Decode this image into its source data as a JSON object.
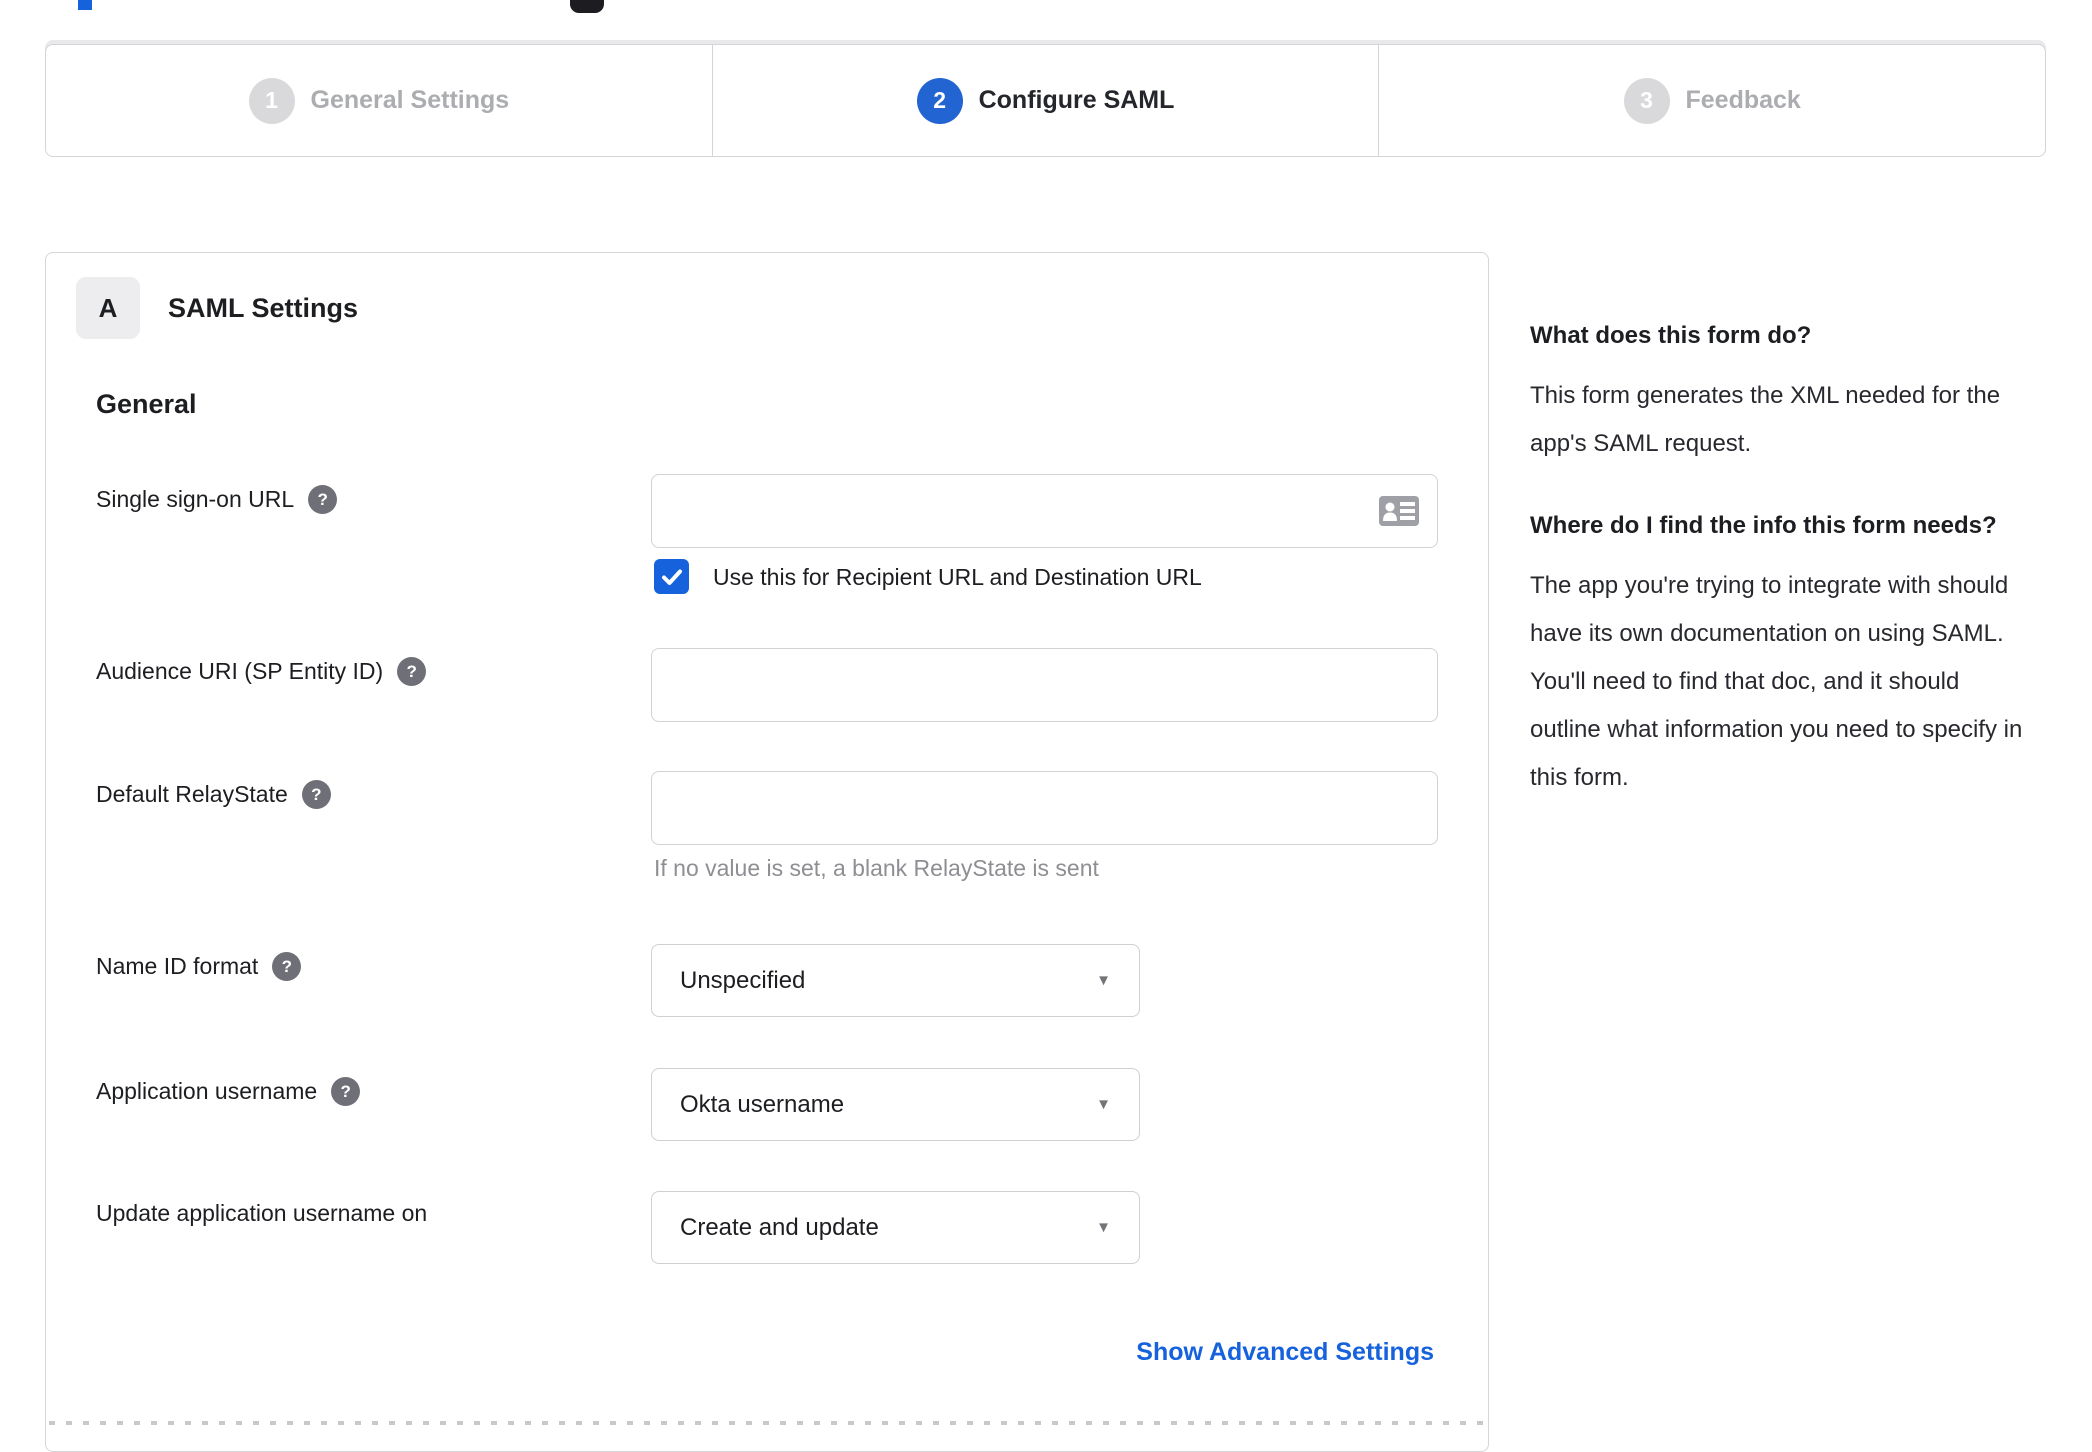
{
  "colors": {
    "accent_blue": "#1662dd",
    "active_step_blue": "#2264d1",
    "inactive_gray": "#abadb0",
    "help_icon_gray": "#6f6f78"
  },
  "stepper": {
    "steps": [
      {
        "number": "1",
        "label": "General Settings",
        "state": "inactive"
      },
      {
        "number": "2",
        "label": "Configure SAML",
        "state": "active"
      },
      {
        "number": "3",
        "label": "Feedback",
        "state": "inactive"
      }
    ]
  },
  "panel": {
    "badge": "A",
    "title": "SAML Settings",
    "section_heading": "General",
    "help_glyph": "?",
    "fields": {
      "sso_url": {
        "label": "Single sign-on URL",
        "value": ""
      },
      "sso_checkbox": {
        "label": "Use this for Recipient URL and Destination URL",
        "checked": true
      },
      "audience_uri": {
        "label": "Audience URI (SP Entity ID)",
        "value": ""
      },
      "relay_state": {
        "label": "Default RelayState",
        "value": "",
        "hint": "If no value is set, a blank RelayState is sent"
      },
      "name_id_format": {
        "label": "Name ID format",
        "value": "Unspecified"
      },
      "app_username": {
        "label": "Application username",
        "value": "Okta username"
      },
      "update_app_username": {
        "label": "Update application username on",
        "value": "Create and update"
      }
    },
    "advanced_link": "Show Advanced Settings"
  },
  "sidebar": {
    "sections": [
      {
        "heading": "What does this form do?",
        "body": "This form generates the XML needed for the app's SAML request."
      },
      {
        "heading": "Where do I find the info this form needs?",
        "body": "The app you're trying to integrate with should have its own documentation on using SAML. You'll need to find that doc, and it should outline what information you need to specify in this form."
      }
    ]
  }
}
